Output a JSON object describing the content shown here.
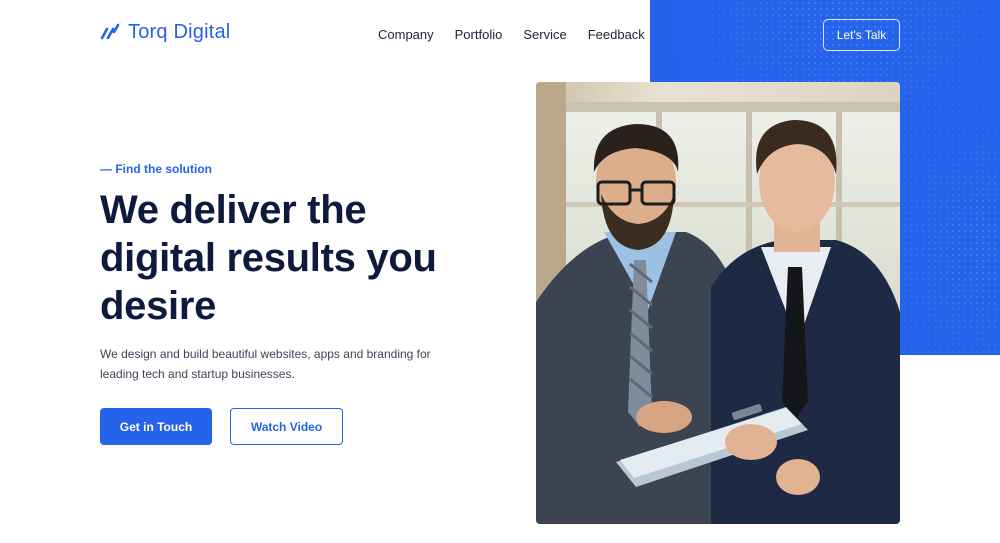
{
  "brand": {
    "name": "Torq Digital",
    "accent_color": "#2563eb",
    "icon": "slash-marks-logo-icon"
  },
  "nav": {
    "items": [
      {
        "label": "Company"
      },
      {
        "label": "Portfolio"
      },
      {
        "label": "Service"
      },
      {
        "label": "Feedback"
      }
    ]
  },
  "header": {
    "cta_label": "Let's Talk"
  },
  "hero": {
    "eyebrow": "— Find the solution",
    "headline_line1": "We deliver the",
    "headline_line2": "digital results you",
    "headline_line3": "desire",
    "description": "We design and build beautiful websites, apps and branding for leading tech and startup businesses.",
    "primary_button": "Get in Touch",
    "secondary_button": "Watch Video",
    "image": "business-meeting-photo"
  },
  "colors": {
    "headline": "#0e1a3d",
    "panel": "#2563eb"
  }
}
